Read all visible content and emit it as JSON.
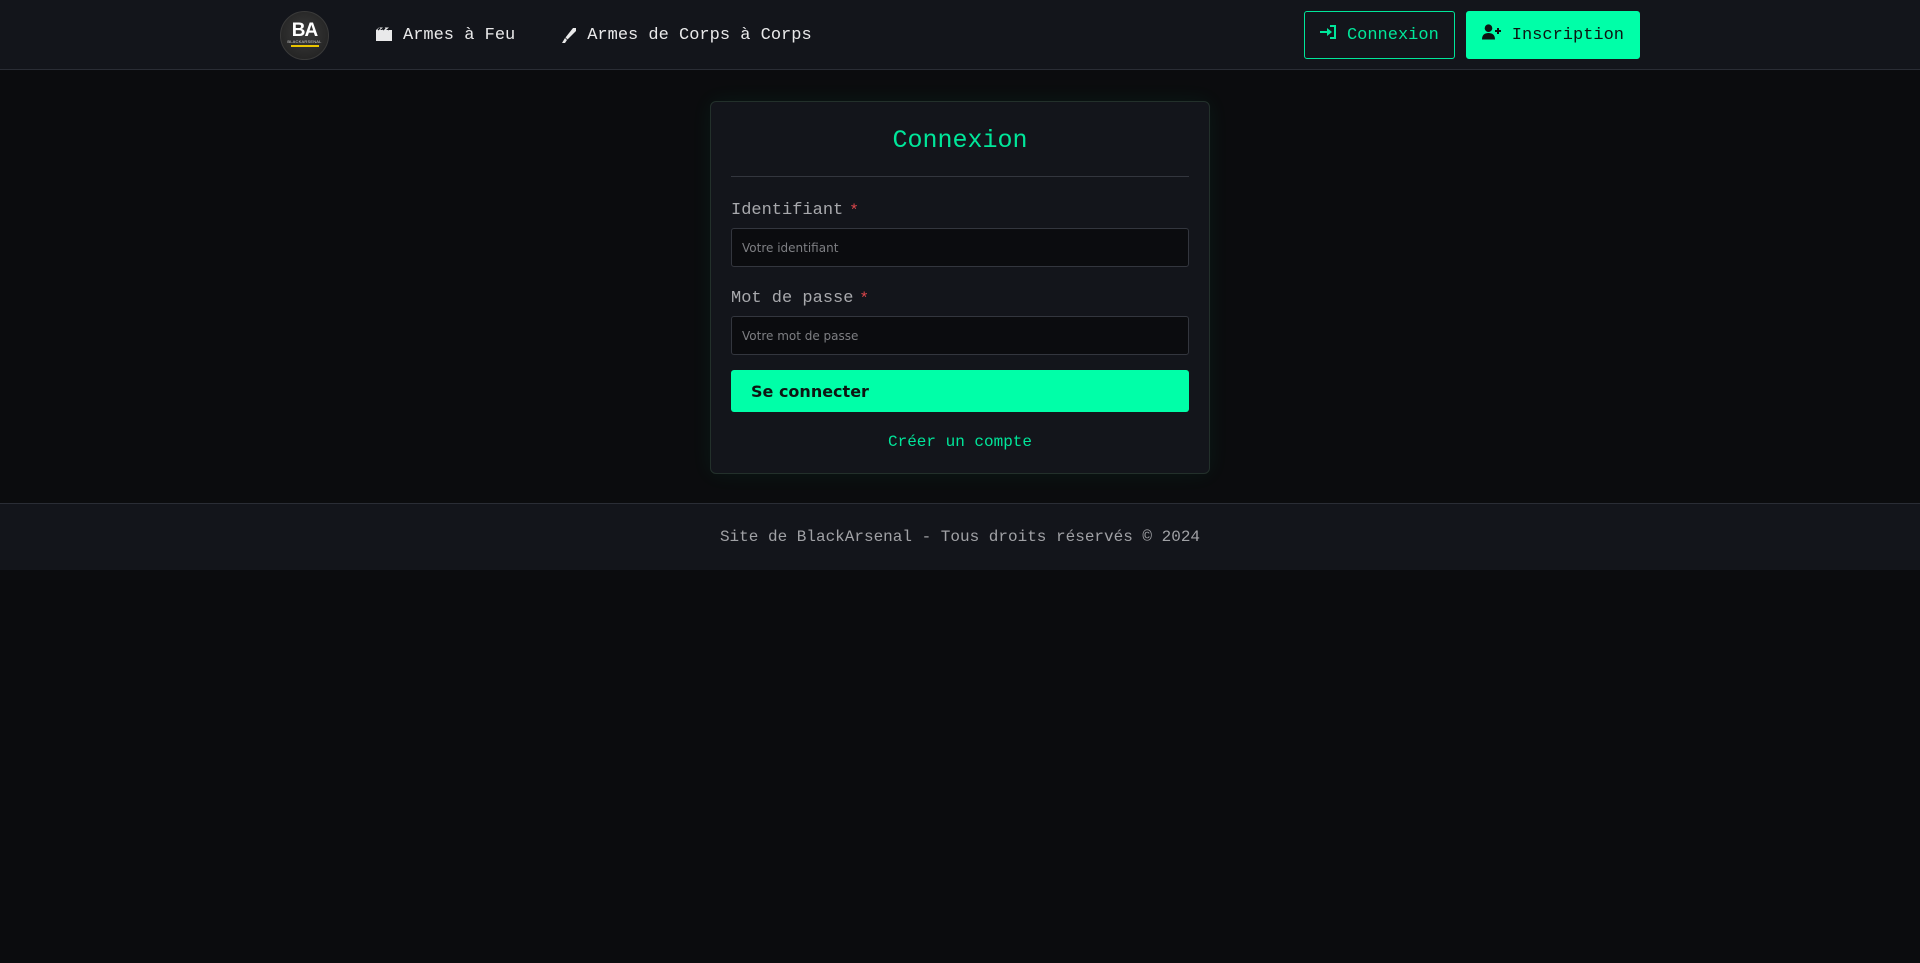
{
  "header": {
    "logo": {
      "mark": "BA",
      "small_text": "BLACKARSENAL",
      "accent_color": "#e9c400"
    },
    "nav": [
      {
        "label": "Armes à Feu",
        "icon": "gun-icon"
      },
      {
        "label": "Armes de Corps à Corps",
        "icon": "knife-icon"
      }
    ],
    "actions": {
      "login_label": "Connexion",
      "login_icon": "login-arrow-icon",
      "signup_label": "Inscription",
      "signup_icon": "user-plus-icon"
    }
  },
  "login_form": {
    "title": "Connexion",
    "username": {
      "label": "Identifiant",
      "required_mark": "*",
      "placeholder": "Votre identifiant",
      "value": ""
    },
    "password": {
      "label": "Mot de passe",
      "required_mark": "*",
      "placeholder": "Votre mot de passe",
      "value": ""
    },
    "submit_label": "Se connecter",
    "create_account_label": "Créer un compte"
  },
  "footer": {
    "text": "Site de BlackArsenal - Tous droits réservés © 2024"
  },
  "colors": {
    "accent": "#00ffa8",
    "accent_text": "#00e69a",
    "background": "#0b0c0e",
    "panel": "#13151b",
    "required": "#e0474c"
  }
}
